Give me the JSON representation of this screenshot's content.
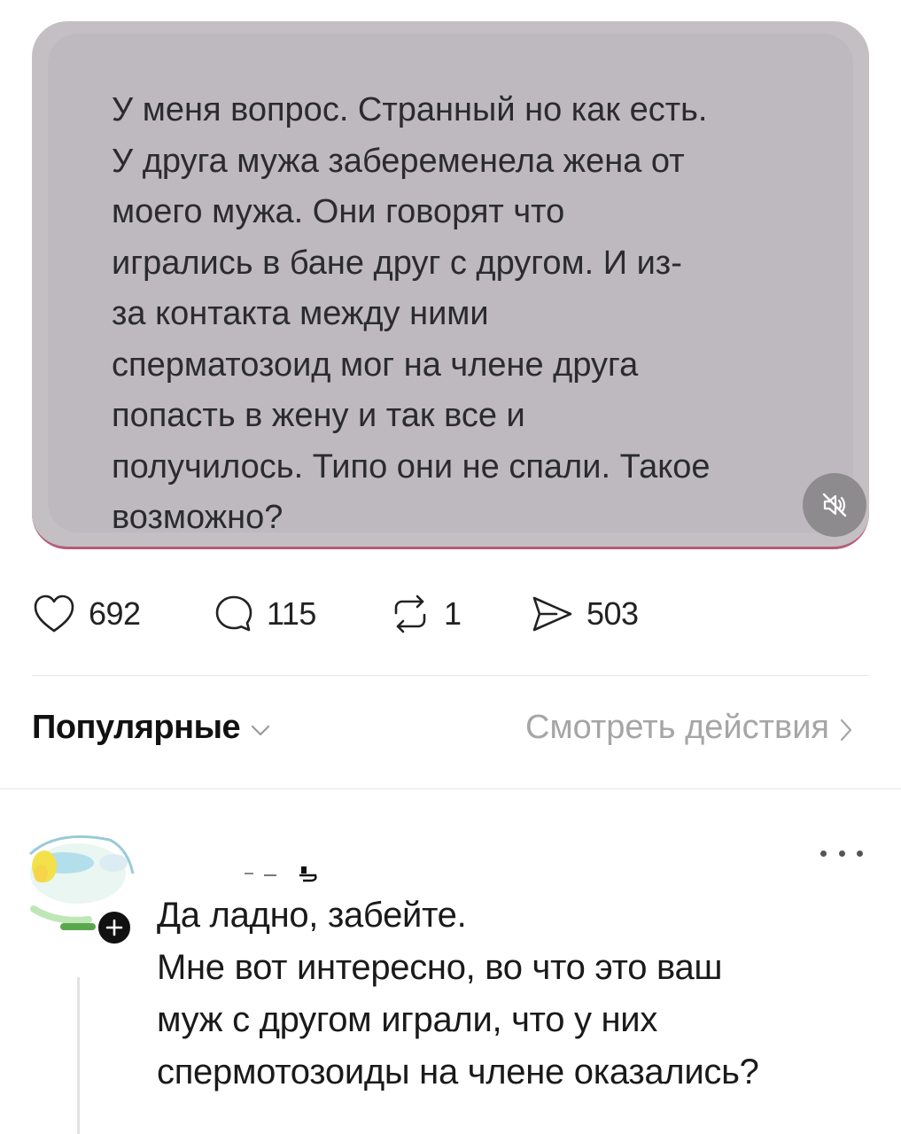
{
  "post": {
    "media_text": "У меня вопрос. Странный но как есть.\nУ друга мужа забеременела жена от\nмоего мужа. Они говорят что\nигрались в бане друг с другом. И из-\nза контакта между ними\nсперматозоид мог на члене друга\nпопасть в жену и так все и\nполучилось. Типо они не спали. Такое\nвозможно?",
    "mute_icon": "speaker-muted-icon"
  },
  "actions": {
    "likes": "692",
    "comments": "115",
    "reposts": "1",
    "shares": "503"
  },
  "sort": {
    "label": "Популярные",
    "view_activity": "Смотреть действия"
  },
  "comment": {
    "username": "",
    "text": "Да ладно, забейте.\nМне вот интересно, во что это ваш\nмуж с другом играли, что у них\nспермотозоиды на члене оказались?"
  },
  "colors": {
    "card_bg": "#c3bfc3",
    "card_accent": "#b65a78",
    "muted_text": "#a6a6a6",
    "text": "#111111"
  }
}
